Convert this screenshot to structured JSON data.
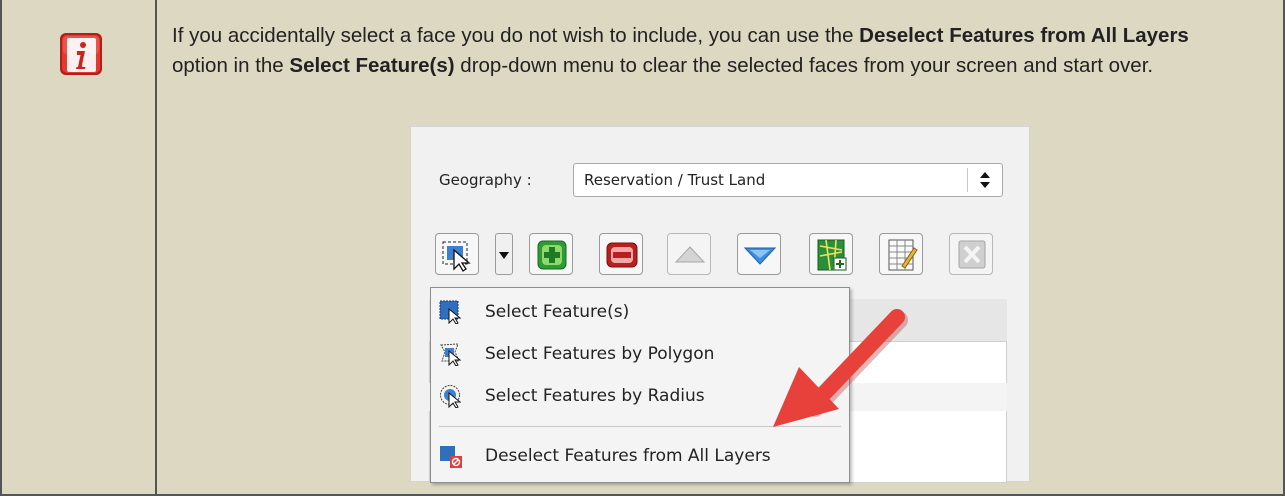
{
  "note": {
    "icon": "info-icon",
    "paragraph": {
      "t1": "If you accidentally select a face you do not wish to include, you can use the ",
      "b1": "Deselect Features from All Layers",
      "t2": " option in the ",
      "b2": "Select Feature(s)",
      "t3": " drop-down menu to clear the selected faces from your screen and start over."
    },
    "colors": {
      "background": "#ddd8c2",
      "icon_red": "#d9322b",
      "arrow_red": "#e8403a"
    }
  },
  "screenshot": {
    "geography_label": "Geography :",
    "geography_value": "Reservation / Trust Land",
    "toolbar_icons": [
      "select-polygon-icon",
      "dropdown-arrow-icon",
      "add-icon",
      "remove-icon",
      "move-up-icon",
      "move-down-icon",
      "map-add-icon",
      "edit-table-icon",
      "clear-icon"
    ],
    "menu_items": [
      {
        "label": "Select Feature(s)",
        "icon": "select-feature-icon"
      },
      {
        "label": "Select Features by Polygon",
        "icon": "select-polygon-icon"
      },
      {
        "label": "Select Features by Radius",
        "icon": "select-radius-icon"
      },
      {
        "label": "Deselect Features from All Layers",
        "icon": "deselect-icon"
      }
    ]
  }
}
